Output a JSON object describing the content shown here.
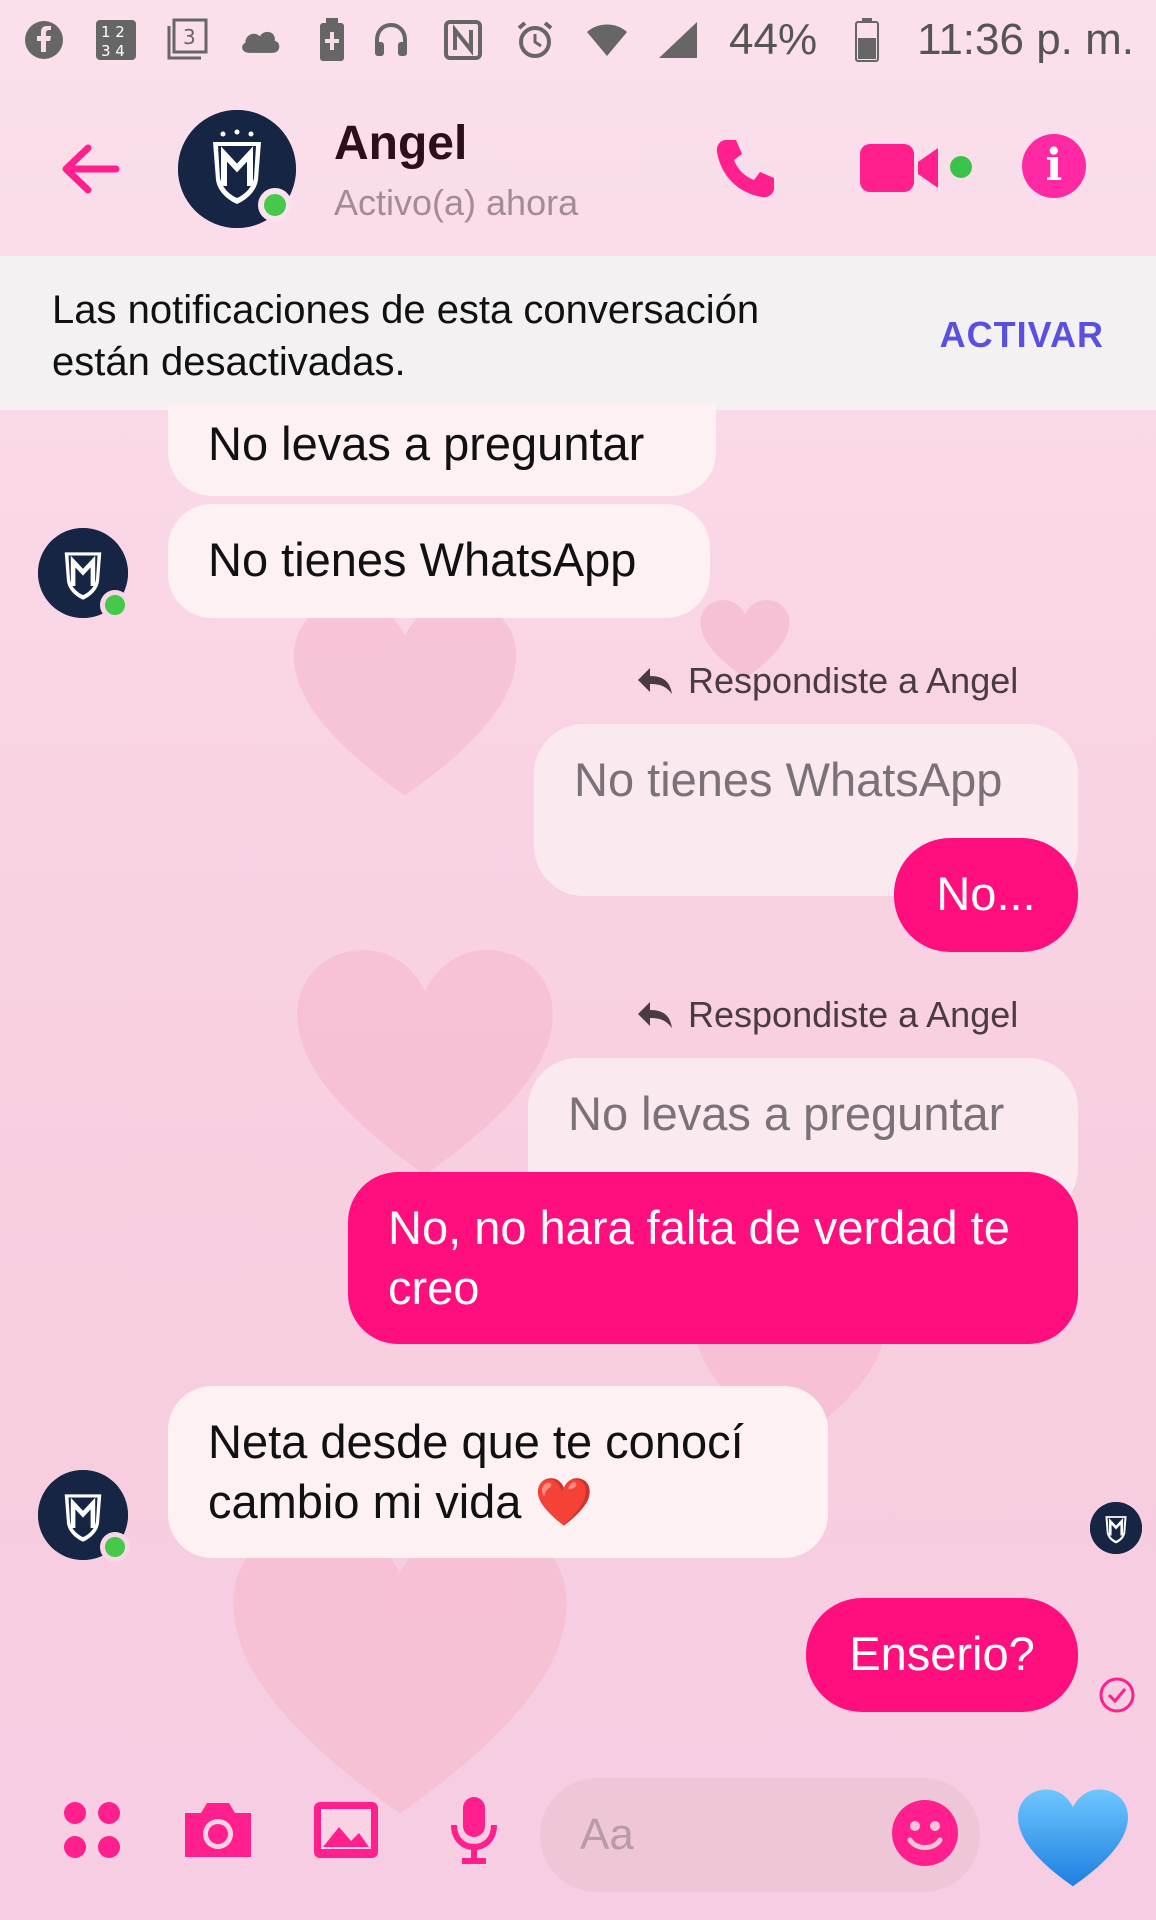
{
  "status_bar": {
    "battery": "44%",
    "time": "11:36 p. m."
  },
  "header": {
    "name": "Angel",
    "status": "Activo(a) ahora"
  },
  "banner": {
    "text": "Las notificaciones de esta conversación están desactivadas.",
    "action": "ACTIVAR"
  },
  "messages": {
    "m1": "No levas a preguntar",
    "m2": "No tienes WhatsApp",
    "reply1_label": "Respondiste a Angel",
    "reply1_quote": "No tienes WhatsApp",
    "reply1_text": "No...",
    "reply2_label": "Respondiste a Angel",
    "reply2_quote": "No levas a preguntar",
    "reply2_text": "No, no hara falta de verdad te creo",
    "m5": "Neta desde que te conocí cambio mi vida ❤️",
    "m6": "Enserio?"
  },
  "composer": {
    "placeholder": "Aa"
  },
  "colors": {
    "accent": "#ff0f7d",
    "activate": "#5a4fe0",
    "online": "#47c84a"
  }
}
